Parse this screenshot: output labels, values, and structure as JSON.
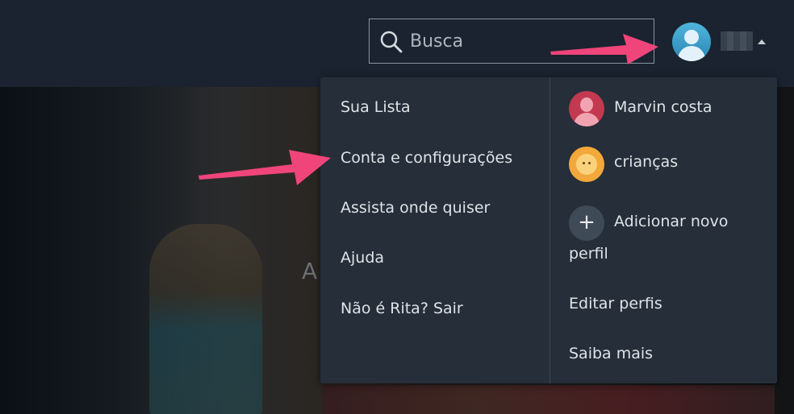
{
  "search": {
    "placeholder": "Busca"
  },
  "menu": {
    "left_items": [
      {
        "label": "Sua Lista"
      },
      {
        "label": "Conta e configurações"
      },
      {
        "label": "Assista onde quiser"
      },
      {
        "label": "Ajuda"
      },
      {
        "label": "Não é Rita? Sair"
      }
    ],
    "profiles": [
      {
        "name": "Marvin costa",
        "icon": "user-avatar-red"
      },
      {
        "name": "crianças",
        "icon": "kids-avatar"
      }
    ],
    "add_profile_line1": "Adicionar novo",
    "add_profile_line2": "perfil",
    "edit_profiles": "Editar perfis",
    "learn_more": "Saiba mais"
  },
  "hero": {
    "partial_letter": "A"
  },
  "colors": {
    "topbar": "#1a232f",
    "menu_bg": "#252e39",
    "arrow": "#f0457a",
    "avatar": "#3fa3cf"
  }
}
